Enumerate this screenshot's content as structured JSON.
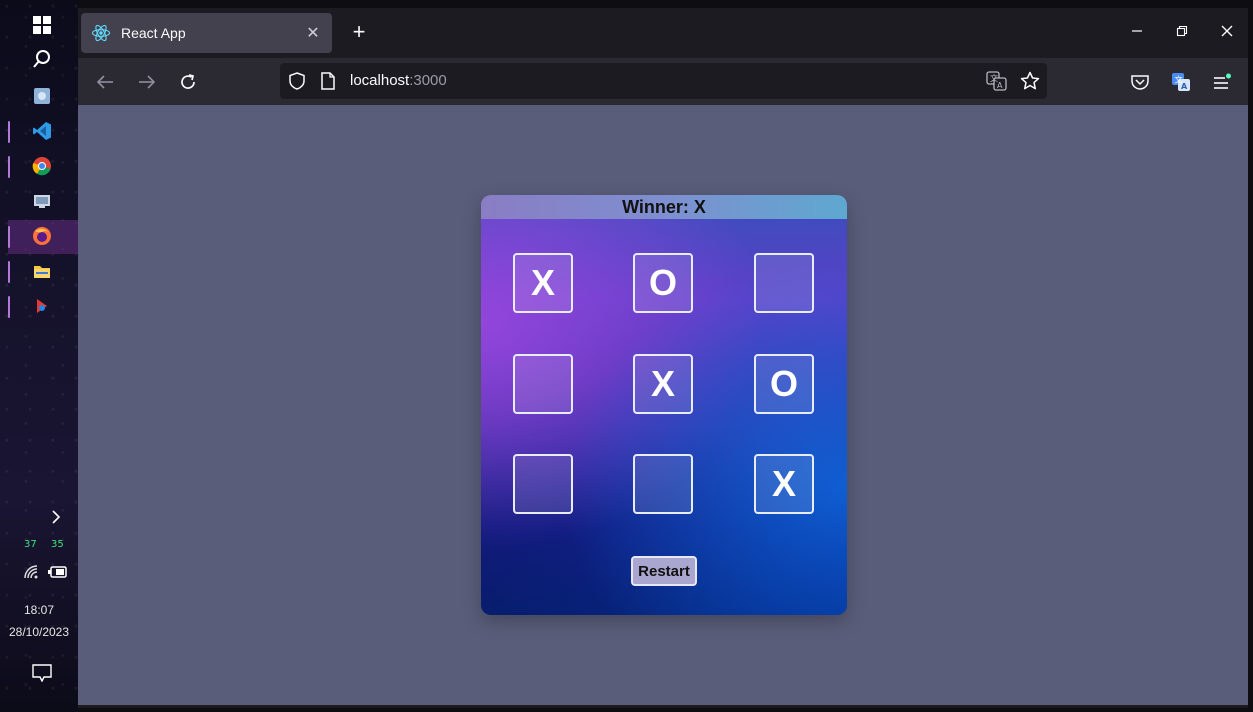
{
  "taskbar": {
    "icons": [
      "windows-start-icon",
      "search-icon",
      "app-icon",
      "vscode-icon",
      "chrome-icon",
      "explorer-icon",
      "firefox-icon",
      "folder-icon",
      "app-icon"
    ],
    "tray": {
      "cpu_temp": "37",
      "gpu_temp": "35",
      "time": "18:07",
      "date": "28/10/2023"
    }
  },
  "browser": {
    "tab_title": "React App",
    "url_host": "localhost",
    "url_port": ":3000"
  },
  "game": {
    "status": "Winner: X",
    "board": [
      "X",
      "O",
      "",
      "",
      "X",
      "O",
      "",
      "",
      "X"
    ],
    "restart_label": "Restart"
  }
}
